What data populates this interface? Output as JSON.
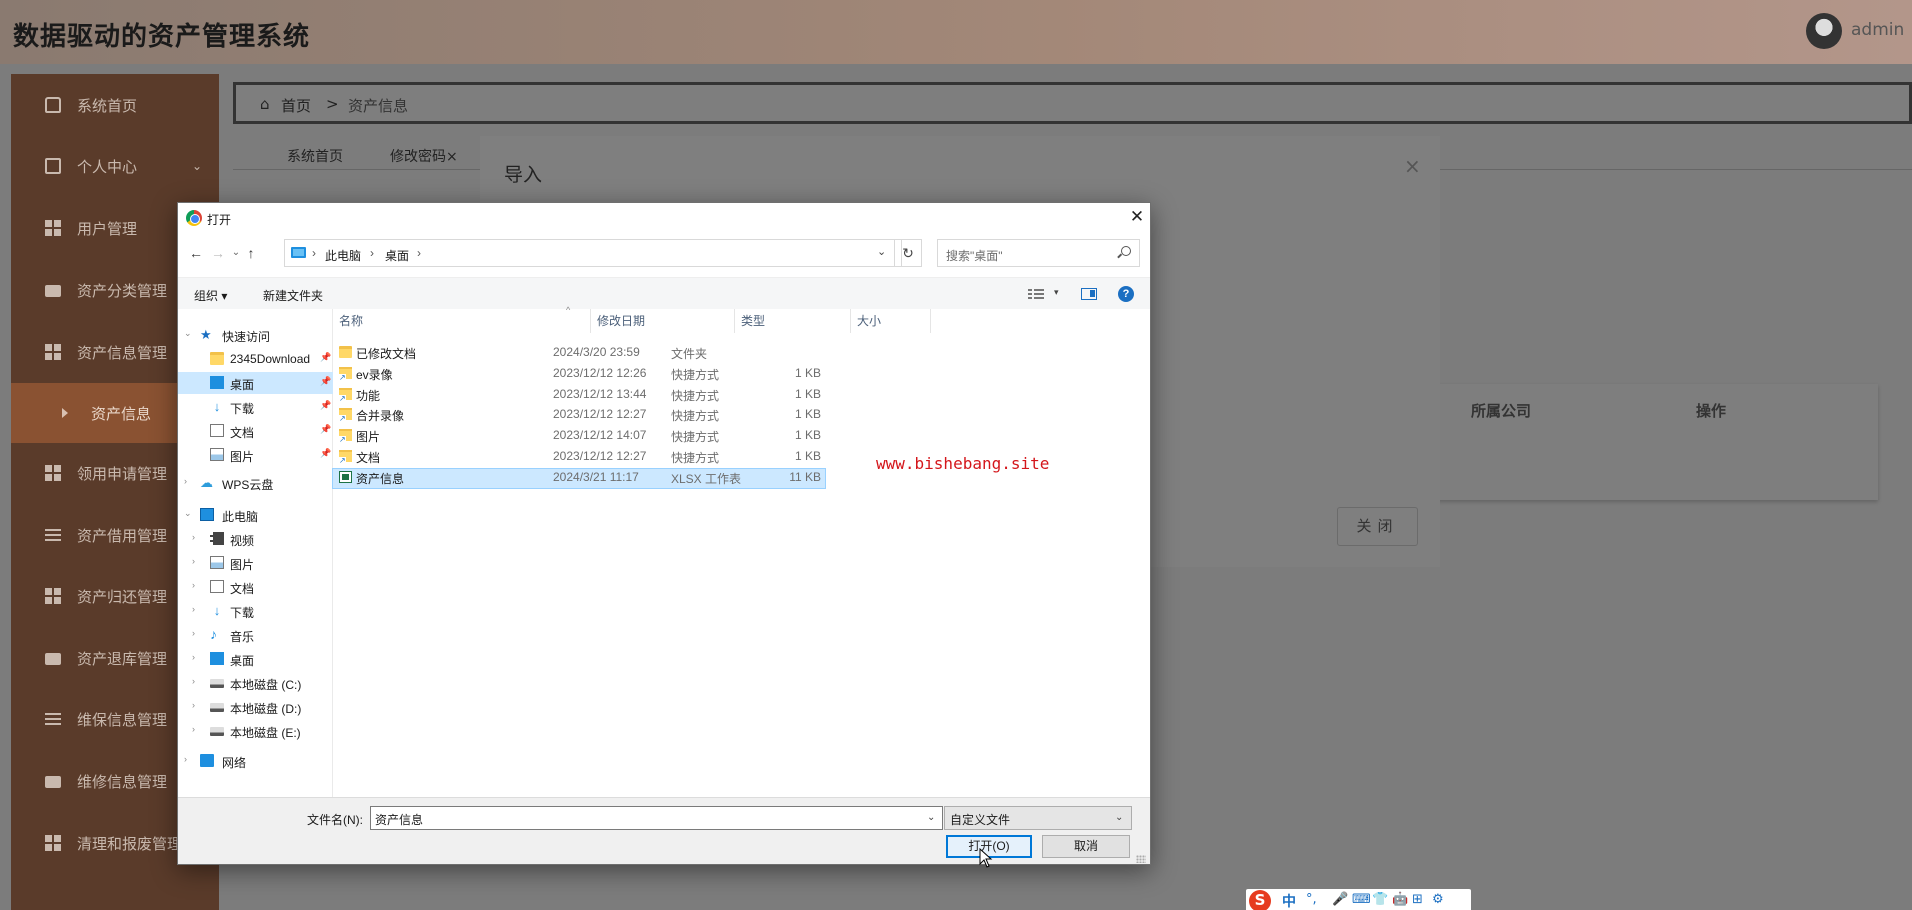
{
  "app": {
    "title": "数据驱动的资产管理系统",
    "user": "admin"
  },
  "sidebar": {
    "items": [
      {
        "label": "系统首页",
        "icon": "home-icon"
      },
      {
        "label": "个人中心",
        "icon": "card-icon",
        "chevron": "⌄"
      },
      {
        "label": "用户管理",
        "icon": "grid-icon"
      },
      {
        "label": "资产分类管理",
        "icon": "case-icon"
      },
      {
        "label": "资产信息管理",
        "icon": "grid-icon"
      },
      {
        "label": "资产信息",
        "icon": "caret-icon",
        "active": true
      },
      {
        "label": "领用申请管理",
        "icon": "grid-icon"
      },
      {
        "label": "资产借用管理",
        "icon": "bars-icon"
      },
      {
        "label": "资产归还管理",
        "icon": "grid-icon"
      },
      {
        "label": "资产退库管理",
        "icon": "case-icon"
      },
      {
        "label": "维保信息管理",
        "icon": "sliders-icon"
      },
      {
        "label": "维修信息管理",
        "icon": "pin-icon"
      },
      {
        "label": "清理和报废管理",
        "icon": "grid-icon"
      }
    ]
  },
  "breadcrumb": {
    "home": "首页",
    "separator": ">",
    "current": "资产信息"
  },
  "tabs": [
    {
      "label": "系统首页"
    },
    {
      "label": "修改密码×"
    }
  ],
  "table": {
    "headers": [
      "所属公司",
      "操作"
    ]
  },
  "import_modal": {
    "title": "导入",
    "close_icon": "×",
    "close_button": "关闭"
  },
  "watermark": "www.bishebang.site",
  "dialog": {
    "title": "打开",
    "close_icon": "✕",
    "nav": {
      "back": "←",
      "forward": "→",
      "recent": "⌄",
      "up": "↑"
    },
    "address": {
      "segments": [
        "此电脑",
        "桌面"
      ],
      "arrow": "›",
      "dropdown": "⌄",
      "refresh": "↻"
    },
    "search_placeholder": "搜索\"桌面\"",
    "toolbar": {
      "organize": "组织 ▾",
      "new_folder": "新建文件夹",
      "view_dropdown": "▾",
      "help": "?"
    },
    "tree": [
      {
        "label": "快速访问",
        "icon": "star-icon",
        "indent": 0,
        "expand": "⌄"
      },
      {
        "label": "2345Download",
        "icon": "folder-icon",
        "indent": 1,
        "pinned": true
      },
      {
        "label": "桌面",
        "icon": "desktop-icon",
        "indent": 1,
        "pinned": true,
        "selected": true
      },
      {
        "label": "下载",
        "icon": "download-icon",
        "indent": 1,
        "pinned": true
      },
      {
        "label": "文档",
        "icon": "document-icon",
        "indent": 1,
        "pinned": true
      },
      {
        "label": "图片",
        "icon": "picture-icon",
        "indent": 1,
        "pinned": true
      },
      {
        "label": "WPS云盘",
        "icon": "cloud-icon",
        "indent": 0,
        "expand": "›"
      },
      {
        "label": "此电脑",
        "icon": "computer-icon",
        "indent": 0,
        "expand": "⌄"
      },
      {
        "label": "视频",
        "icon": "video-icon",
        "indent": 1,
        "expand": "›"
      },
      {
        "label": "图片",
        "icon": "picture-icon",
        "indent": 1,
        "expand": "›"
      },
      {
        "label": "文档",
        "icon": "document-icon",
        "indent": 1,
        "expand": "›"
      },
      {
        "label": "下载",
        "icon": "download-icon",
        "indent": 1,
        "expand": "›"
      },
      {
        "label": "音乐",
        "icon": "music-icon",
        "indent": 1,
        "expand": "›"
      },
      {
        "label": "桌面",
        "icon": "desktop-icon",
        "indent": 1,
        "expand": "›"
      },
      {
        "label": "本地磁盘 (C:)",
        "icon": "disk-icon",
        "indent": 1,
        "expand": "›"
      },
      {
        "label": "本地磁盘 (D:)",
        "icon": "disk-icon",
        "indent": 1,
        "expand": "›"
      },
      {
        "label": "本地磁盘 (E:)",
        "icon": "disk-icon",
        "indent": 1,
        "expand": "›"
      },
      {
        "label": "网络",
        "icon": "network-icon",
        "indent": 0,
        "expand": "›"
      }
    ],
    "columns": [
      "名称",
      "修改日期",
      "类型",
      "大小"
    ],
    "sort_indicator": "^",
    "files": [
      {
        "name": "已修改文档",
        "date": "2024/3/20 23:59",
        "type": "文件夹",
        "size": "",
        "icon": "folder-icon"
      },
      {
        "name": "ev录像",
        "date": "2023/12/12 12:26",
        "type": "快捷方式",
        "size": "1 KB",
        "icon": "shortcut-icon"
      },
      {
        "name": "功能",
        "date": "2023/12/12 13:44",
        "type": "快捷方式",
        "size": "1 KB",
        "icon": "shortcut-icon"
      },
      {
        "name": "合并录像",
        "date": "2023/12/12 12:27",
        "type": "快捷方式",
        "size": "1 KB",
        "icon": "shortcut-icon"
      },
      {
        "name": "图片",
        "date": "2023/12/12 14:07",
        "type": "快捷方式",
        "size": "1 KB",
        "icon": "shortcut-icon"
      },
      {
        "name": "文档",
        "date": "2023/12/12 12:27",
        "type": "快捷方式",
        "size": "1 KB",
        "icon": "shortcut-icon"
      },
      {
        "name": "资产信息",
        "date": "2024/3/21 11:17",
        "type": "XLSX 工作表",
        "size": "11 KB",
        "icon": "xlsx-icon",
        "selected": true
      }
    ],
    "filename_label": "文件名(N):",
    "filename_value": "资产信息",
    "filename_dropdown": "⌄",
    "filetype_value": "自定义文件",
    "filetype_dropdown": "⌄",
    "open_button": "打开(O)",
    "cancel_button": "取消"
  },
  "ime": {
    "logo": "S",
    "mode": "中",
    "glyphs": [
      "°,",
      "🎤",
      "⌨",
      "👕",
      "🤖",
      "⊞",
      "⚙"
    ]
  }
}
